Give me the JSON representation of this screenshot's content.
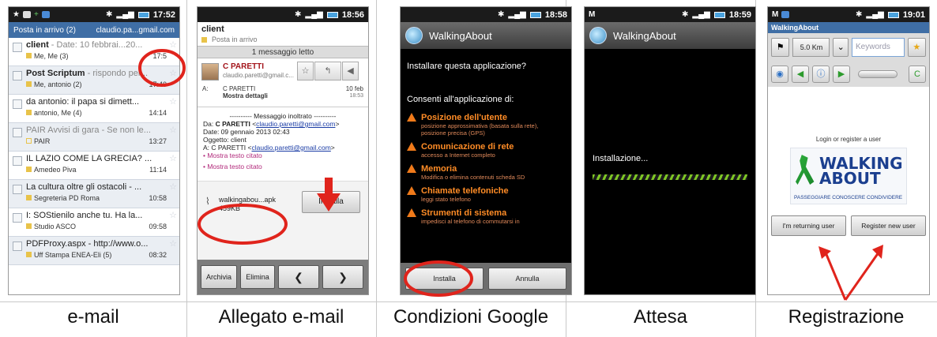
{
  "captions": [
    "e-mail",
    "Allegato e-mail",
    "Condizioni Google",
    "Attesa",
    "Registrazione"
  ],
  "panel1": {
    "time": "17:52",
    "folder": "Posta in arrivo (2)",
    "account": "claudio.pa...gmail.com",
    "mails": [
      {
        "subject_bold": "client",
        "subject_rest": " - Date: 10 febbrai...20...",
        "from": "Me, Me (3)",
        "time": "17:5"
      },
      {
        "subject_bold": "Post Scriptum",
        "subject_rest": " - rispondo per...",
        "from": "Me, antonio (2)",
        "time": "17:40"
      },
      {
        "subject_bold": "",
        "subject_rest": "da antonio: il papa si dimett...",
        "from": "antonio, Me (4)",
        "time": "14:14"
      },
      {
        "subject_bold": "",
        "subject_rest": "PAIR Avvisi di gara - Se non le...",
        "from": "PAIR",
        "time": "13:27"
      },
      {
        "subject_bold": "",
        "subject_rest": "IL LAZIO COME LA GRECIA? ...",
        "from": "Amedeo Piva",
        "time": "11:14"
      },
      {
        "subject_bold": "",
        "subject_rest": "La cultura oltre gli ostacoli - ...",
        "from": "Segreteria PD Roma",
        "time": "10:58"
      },
      {
        "subject_bold": "",
        "subject_rest": "I: SOStienilo anche tu. Ha la...",
        "from": "Studio ASCO",
        "time": "09:58"
      },
      {
        "subject_bold": "",
        "subject_rest": "PDFProxy.aspx - http://www.o...",
        "from": "Uff Stampa ENEA-Eli (5)",
        "time": "08:32"
      }
    ]
  },
  "panel2": {
    "time": "18:56",
    "title": "client",
    "label": "Posta in arrivo",
    "read_status": "1 messaggio letto",
    "sender": "C PARETTI",
    "sender_mail": "claudio.paretti@gmail.c...",
    "to_label": "A:",
    "to_name": "C PARETTI",
    "details": "Mostra dettagli",
    "date": "10 feb",
    "hour": "18:53",
    "body": {
      "forward": "---------- Messaggio inoltrato ----------",
      "da_label": "Da: ",
      "da_name": "C PARETTI",
      "da_mail": "claudio.paretti@gmail.com",
      "date_line": "Date: 09 gennaio 2013 02:43",
      "subject_line": "Oggetto: client",
      "to_line_label": "A: C PARETTI ",
      "to_line_mail": "claudio.paretti@gmail.com",
      "quoted": "• Mostra testo citato",
      "quoted2": "• Mostra testo citato"
    },
    "attachment_name": "walkingabou...apk",
    "attachment_size": "459KB",
    "install": "Installa",
    "archive": "Archivia",
    "delete": "Elimina"
  },
  "panel3": {
    "time": "18:58",
    "app": "WalkingAbout",
    "question": "Installare questa applicazione?",
    "consent": "Consenti all'applicazione di:",
    "permissions": [
      {
        "title": "Posizione dell'utente",
        "desc": "posizione approssimativa (basata sulla rete), posizione precisa (GPS)"
      },
      {
        "title": "Comunicazione di rete",
        "desc": "accesso a Internet completo"
      },
      {
        "title": "Memoria",
        "desc": "Modifica o elimina contenuti scheda SD"
      },
      {
        "title": "Chiamate telefoniche",
        "desc": "leggi stato telefono"
      },
      {
        "title": "Strumenti di sistema",
        "desc": "impedisci al telefono di commutarsi in"
      }
    ],
    "install": "Installa",
    "cancel": "Annulla"
  },
  "panel4": {
    "time": "18:59",
    "app": "WalkingAbout",
    "status": "Installazione..."
  },
  "panel5": {
    "time": "19:01",
    "title": "WalkingAbout",
    "km": "5.0 Km",
    "keywords_placeholder": "Keywords",
    "login_text": "Login or register a user",
    "logo_line1": "WALKING",
    "logo_line2": "ABOUT",
    "logo_sub": "PASSEGGIARE CONOSCERE CONDIVIDERE",
    "returning": "I'm returning user",
    "register": "Register new user"
  },
  "colors": {
    "annotation_red": "#e0241c",
    "header_blue": "#3f6ea5",
    "warning_orange": "#ff8c26"
  }
}
